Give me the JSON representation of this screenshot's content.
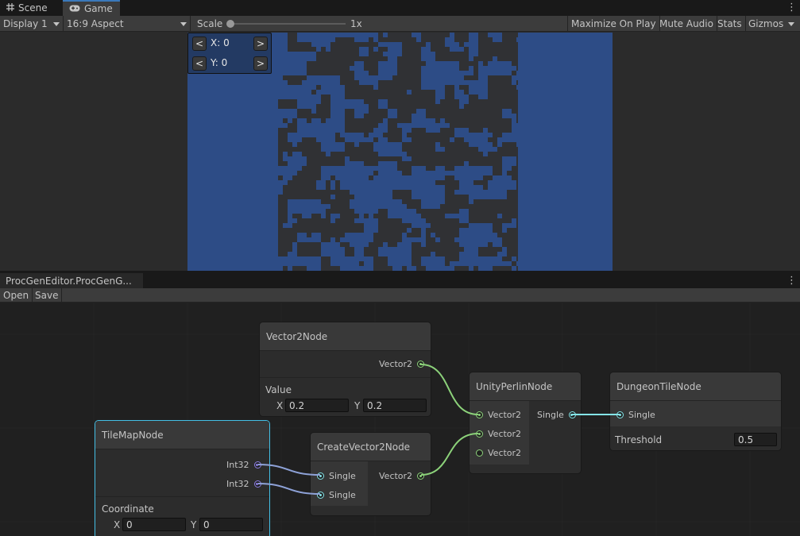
{
  "tabs": [
    {
      "label": "Scene",
      "icon": "grid-icon"
    },
    {
      "label": "Game",
      "icon": "gamepad-icon"
    }
  ],
  "game_toolbar": {
    "display": "Display 1",
    "aspect": "16:9 Aspect",
    "scale_label": "Scale",
    "scale_value": "1x",
    "scale_fraction": 0.0,
    "maximize": "Maximize On Play",
    "mute": "Mute Audio",
    "stats": "Stats",
    "gizmos": "Gizmos"
  },
  "game_view": {
    "background_color": "#2d4c86",
    "tile_dark_color": "#303134",
    "coord_panel": {
      "prev_label": "<",
      "next_label": ">",
      "x_label": "X: 0",
      "y_label": "Y: 0"
    }
  },
  "graph_window": {
    "tab_title": "ProcGenEditor.ProcGenG...",
    "open_label": "Open",
    "save_label": "Save"
  },
  "nodes": {
    "vector2": {
      "title": "Vector2Node",
      "output": "Vector2",
      "field_label": "Value",
      "x_label": "X",
      "x_value": "0.2",
      "y_label": "Y",
      "y_value": "0.2"
    },
    "perlin": {
      "title": "UnityPerlinNode",
      "inputs": [
        "Vector2",
        "Vector2",
        "Vector2"
      ],
      "output": "Single"
    },
    "dungeon": {
      "title": "DungeonTileNode",
      "input": "Single",
      "field_label": "Threshold",
      "field_value": "0.5"
    },
    "tilemap": {
      "title": "TileMapNode",
      "outputs": [
        "Int32",
        "Int32"
      ],
      "field_label": "Coordinate",
      "x_label": "X",
      "x_value": "0",
      "y_label": "Y",
      "y_value": "0"
    },
    "createvec": {
      "title": "CreateVector2Node",
      "inputs": [
        "Single",
        "Single"
      ],
      "output": "Vector2"
    }
  },
  "colors": {
    "vector_port": "#8cd27a",
    "single_port": "#84e4e7",
    "int_port": "#8c7ee0",
    "selected_border": "#44c0e6"
  }
}
